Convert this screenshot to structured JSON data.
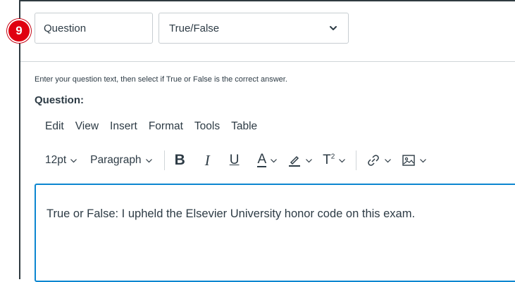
{
  "step": {
    "number": "9"
  },
  "question_title": {
    "value": "Question"
  },
  "question_type": {
    "selected": "True/False"
  },
  "instructions": "Enter your question text, then select if True or False is the correct answer.",
  "question_label": "Question:",
  "menu": [
    "Edit",
    "View",
    "Insert",
    "Format",
    "Tools",
    "Table"
  ],
  "toolbar": {
    "font_size": "12pt",
    "block_format": "Paragraph",
    "bold": "B",
    "italic": "I",
    "underline": "U",
    "text_color": "A",
    "superscript_base": "T",
    "superscript_exp": "2"
  },
  "editor": {
    "content": "True or False: I upheld the Elsevier University honor code on this exam."
  },
  "colors": {
    "badge": "#e00010",
    "focus": "#0b86d0",
    "text": "#2d3b45"
  }
}
